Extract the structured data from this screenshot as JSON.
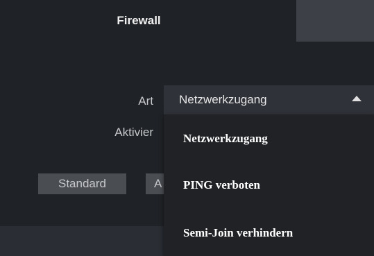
{
  "tabs": [
    {
      "label": "Firewall",
      "active": true
    },
    {
      "label": "",
      "active": false
    }
  ],
  "form": {
    "art_label": "Art",
    "art_value": "Netzwerkzugang",
    "aktivieren_label": "Aktivier"
  },
  "buttons": {
    "standard": "Standard",
    "second": "A"
  },
  "dropdown": {
    "options": [
      "Netzwerkzugang",
      "PING verboten",
      "Semi-Join verhindern"
    ]
  },
  "icons": {
    "select_caret": "caret-up-icon"
  },
  "colors": {
    "background": "#1f2226",
    "tab_inactive": "#3d4046",
    "button": "#4a4d52",
    "dropdown": "#202226"
  }
}
